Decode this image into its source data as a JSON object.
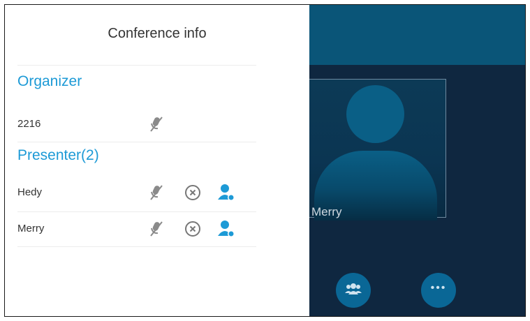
{
  "panel": {
    "title": "Conference info",
    "organizer_heading": "Organizer",
    "presenter_heading": "Presenter(2)",
    "organizer": [
      {
        "name": "2216",
        "icons": [
          "mic-muted-icon"
        ]
      }
    ],
    "presenters": [
      {
        "name": "Hedy",
        "icons": [
          "mic-muted-icon",
          "remove-icon",
          "presenter-role-icon"
        ]
      },
      {
        "name": "Merry",
        "icons": [
          "mic-muted-icon",
          "remove-icon",
          "presenter-role-icon"
        ]
      }
    ]
  },
  "video": {
    "participant_name": "Merry"
  },
  "controls": {
    "participants_icon": "participants-icon",
    "more_icon": "more-icon",
    "more_glyph": "•••"
  },
  "colors": {
    "accent": "#1d9ad6",
    "call_background": "#0f2740",
    "call_top_band": "#0a5578",
    "button": "#0a6796"
  }
}
